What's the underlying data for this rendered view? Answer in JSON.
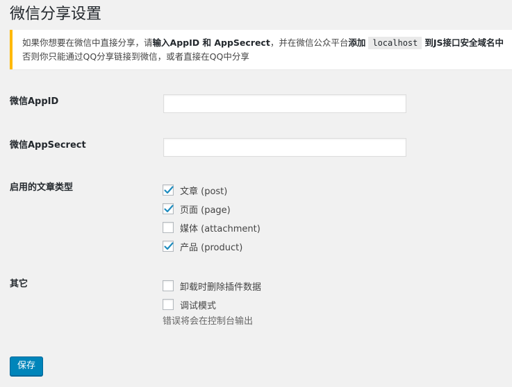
{
  "page": {
    "title": "微信分享设置"
  },
  "notice": {
    "part1": "如果你想要在微信中直接分享，请",
    "part2": "输入AppID 和 AppSecrect",
    "part3": "，并在微信公众平台",
    "part4": "添加",
    "code": "localhost",
    "part5": "到JS接口安全域名中",
    "line2": "否则你只能通过QQ分享链接到微信，或者直接在QQ中分享"
  },
  "fields": {
    "appid_label": "微信AppID",
    "appid_value": "",
    "appsecret_label": "微信AppSecrect",
    "appsecret_value": ""
  },
  "post_types": {
    "label": "启用的文章类型",
    "items": [
      {
        "label": "文章 (post)",
        "checked": true
      },
      {
        "label": "页面 (page)",
        "checked": true
      },
      {
        "label": "媒体 (attachment)",
        "checked": false
      },
      {
        "label": "产品 (product)",
        "checked": true
      }
    ]
  },
  "other": {
    "label": "其它",
    "items": [
      {
        "label": "卸载时删除插件数据",
        "checked": false
      },
      {
        "label": "调试模式",
        "checked": false
      }
    ],
    "hint": "错误将会在控制台输出"
  },
  "actions": {
    "save_label": "保存"
  },
  "colors": {
    "primary": "#0085ba",
    "notice_border": "#ffb900",
    "check": "#1e8cbe"
  }
}
